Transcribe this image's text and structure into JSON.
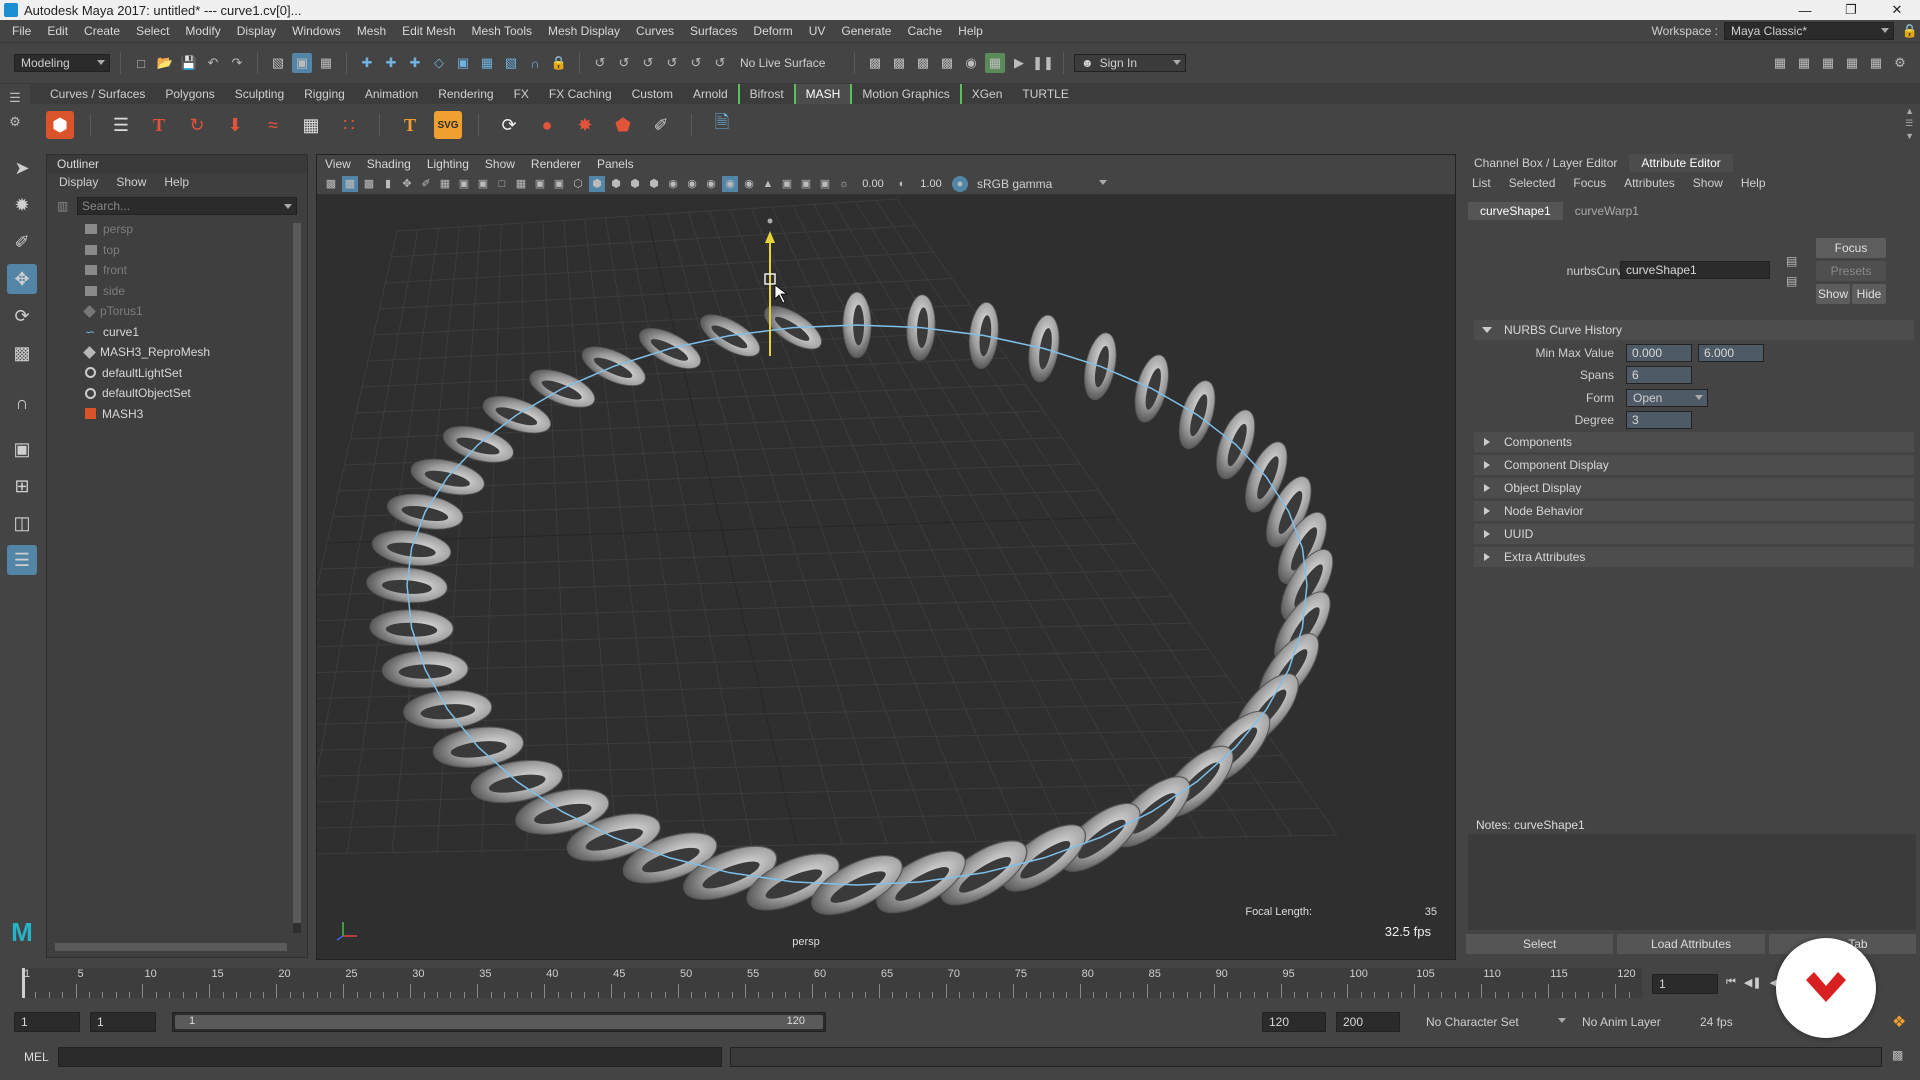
{
  "window": {
    "title": "Autodesk Maya 2017: untitled*   ---   curve1.cv[0]...",
    "controls": [
      "—",
      "❐",
      "✕"
    ]
  },
  "menubar": {
    "items": [
      "File",
      "Edit",
      "Create",
      "Select",
      "Modify",
      "Display",
      "Windows",
      "Mesh",
      "Edit Mesh",
      "Mesh Tools",
      "Mesh Display",
      "Curves",
      "Surfaces",
      "Deform",
      "UV",
      "Generate",
      "Cache",
      "Help"
    ],
    "workspace_label": "Workspace :",
    "workspace_value": "Maya Classic*"
  },
  "statusline": {
    "menuset": "Modeling",
    "live_surface": "No Live Surface",
    "sign_in": "Sign In"
  },
  "shelf": {
    "tabs": [
      "Curves / Surfaces",
      "Polygons",
      "Sculpting",
      "Rigging",
      "Animation",
      "Rendering",
      "FX",
      "FX Caching",
      "Custom",
      "Arnold",
      "Bifrost",
      "MASH",
      "Motion Graphics",
      "XGen",
      "TURTLE"
    ],
    "active_tab": "MASH"
  },
  "outliner": {
    "title": "Outliner",
    "menu": [
      "Display",
      "Show",
      "Help"
    ],
    "search_placeholder": "Search...",
    "items": [
      {
        "label": "persp",
        "icon": "camera-icon",
        "dim": true
      },
      {
        "label": "top",
        "icon": "camera-icon",
        "dim": true
      },
      {
        "label": "front",
        "icon": "camera-icon",
        "dim": true
      },
      {
        "label": "side",
        "icon": "camera-icon",
        "dim": true
      },
      {
        "label": "pTorus1",
        "icon": "mesh-icon",
        "dim": true
      },
      {
        "label": "curve1",
        "icon": "curve-icon",
        "dim": false
      },
      {
        "label": "MASH3_ReproMesh",
        "icon": "mesh-icon",
        "dim": false
      },
      {
        "label": "defaultLightSet",
        "icon": "set-icon",
        "dim": false
      },
      {
        "label": "defaultObjectSet",
        "icon": "set-icon",
        "dim": false
      },
      {
        "label": "MASH3",
        "icon": "mash-icon",
        "dim": false
      }
    ]
  },
  "viewport": {
    "menu": [
      "View",
      "Shading",
      "Lighting",
      "Show",
      "Renderer",
      "Panels"
    ],
    "exposure": "0.00",
    "gamma": "1.00",
    "color_space": "sRGB gamma",
    "camera_label": "persp",
    "focal_length_label": "Focal Length:",
    "focal_length_value": "35",
    "fps": "32.5 fps"
  },
  "attribute_editor": {
    "tabs": [
      "Channel Box / Layer Editor",
      "Attribute Editor"
    ],
    "active_tab": "Attribute Editor",
    "menu": [
      "List",
      "Selected",
      "Focus",
      "Attributes",
      "Show",
      "Help"
    ],
    "node_tabs": [
      "curveShape1",
      "curveWarp1"
    ],
    "node_type_label": "nurbsCurve:",
    "node_name": "curveShape1",
    "focus_button": "Focus",
    "presets_button": "Presets",
    "show_button": "Show",
    "hide_button": "Hide",
    "history_section": "NURBS Curve History",
    "min_max_label": "Min Max Value",
    "min_value": "0.000",
    "max_value": "6.000",
    "spans_label": "Spans",
    "spans_value": "6",
    "form_label": "Form",
    "form_value": "Open",
    "degree_label": "Degree",
    "degree_value": "3",
    "collapsed_sections": [
      "Components",
      "Component Display",
      "Object Display",
      "Node Behavior",
      "UUID",
      "Extra Attributes"
    ],
    "notes_label": "Notes:  curveShape1",
    "bottom_buttons": [
      "Select",
      "Load Attributes",
      "Copy Tab"
    ]
  },
  "timeline": {
    "ticks": [
      "5",
      "10",
      "15",
      "20",
      "25",
      "30",
      "35",
      "40",
      "45",
      "50",
      "55",
      "60",
      "65",
      "70",
      "75",
      "80",
      "85",
      "90",
      "95",
      "100",
      "105",
      "110",
      "115",
      "120"
    ],
    "first_tick": "1",
    "current_frame": "1"
  },
  "range": {
    "start_frame": "1",
    "playback_start": "1",
    "slider_start": "1",
    "slider_end": "120",
    "playback_end": "120",
    "end_frame": "200",
    "character_set": "No Character Set",
    "anim_layer": "No Anim Layer",
    "fps": "24 fps"
  },
  "cmdline": {
    "label": "MEL"
  }
}
